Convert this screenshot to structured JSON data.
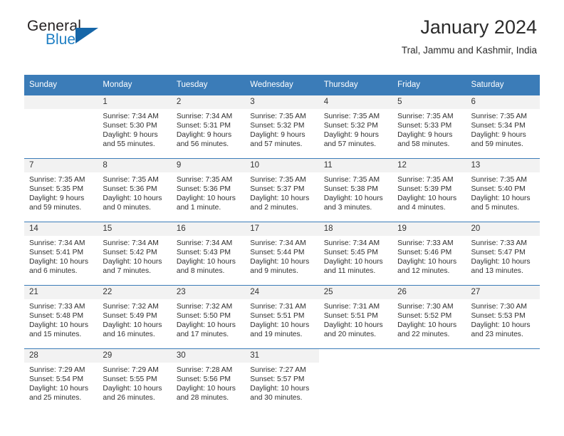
{
  "brand": {
    "name_top": "General",
    "name_bottom": "Blue",
    "triangle_color": "#1666a8",
    "blue_color": "#1f7fc4"
  },
  "header": {
    "title": "January 2024",
    "location": "Tral, Jammu and Kashmir, India"
  },
  "theme": {
    "header_blue": "#3b7cb8",
    "cell_head_gray": "#f2f2f2"
  },
  "calendar": {
    "weekday_headers": [
      "Sunday",
      "Monday",
      "Tuesday",
      "Wednesday",
      "Thursday",
      "Friday",
      "Saturday"
    ],
    "weeks": [
      [
        {
          "day": "",
          "lines": []
        },
        {
          "day": "1",
          "lines": [
            "Sunrise: 7:34 AM",
            "Sunset: 5:30 PM",
            "Daylight: 9 hours",
            "and 55 minutes."
          ]
        },
        {
          "day": "2",
          "lines": [
            "Sunrise: 7:34 AM",
            "Sunset: 5:31 PM",
            "Daylight: 9 hours",
            "and 56 minutes."
          ]
        },
        {
          "day": "3",
          "lines": [
            "Sunrise: 7:35 AM",
            "Sunset: 5:32 PM",
            "Daylight: 9 hours",
            "and 57 minutes."
          ]
        },
        {
          "day": "4",
          "lines": [
            "Sunrise: 7:35 AM",
            "Sunset: 5:32 PM",
            "Daylight: 9 hours",
            "and 57 minutes."
          ]
        },
        {
          "day": "5",
          "lines": [
            "Sunrise: 7:35 AM",
            "Sunset: 5:33 PM",
            "Daylight: 9 hours",
            "and 58 minutes."
          ]
        },
        {
          "day": "6",
          "lines": [
            "Sunrise: 7:35 AM",
            "Sunset: 5:34 PM",
            "Daylight: 9 hours",
            "and 59 minutes."
          ]
        }
      ],
      [
        {
          "day": "7",
          "lines": [
            "Sunrise: 7:35 AM",
            "Sunset: 5:35 PM",
            "Daylight: 9 hours",
            "and 59 minutes."
          ]
        },
        {
          "day": "8",
          "lines": [
            "Sunrise: 7:35 AM",
            "Sunset: 5:36 PM",
            "Daylight: 10 hours",
            "and 0 minutes."
          ]
        },
        {
          "day": "9",
          "lines": [
            "Sunrise: 7:35 AM",
            "Sunset: 5:36 PM",
            "Daylight: 10 hours",
            "and 1 minute."
          ]
        },
        {
          "day": "10",
          "lines": [
            "Sunrise: 7:35 AM",
            "Sunset: 5:37 PM",
            "Daylight: 10 hours",
            "and 2 minutes."
          ]
        },
        {
          "day": "11",
          "lines": [
            "Sunrise: 7:35 AM",
            "Sunset: 5:38 PM",
            "Daylight: 10 hours",
            "and 3 minutes."
          ]
        },
        {
          "day": "12",
          "lines": [
            "Sunrise: 7:35 AM",
            "Sunset: 5:39 PM",
            "Daylight: 10 hours",
            "and 4 minutes."
          ]
        },
        {
          "day": "13",
          "lines": [
            "Sunrise: 7:35 AM",
            "Sunset: 5:40 PM",
            "Daylight: 10 hours",
            "and 5 minutes."
          ]
        }
      ],
      [
        {
          "day": "14",
          "lines": [
            "Sunrise: 7:34 AM",
            "Sunset: 5:41 PM",
            "Daylight: 10 hours",
            "and 6 minutes."
          ]
        },
        {
          "day": "15",
          "lines": [
            "Sunrise: 7:34 AM",
            "Sunset: 5:42 PM",
            "Daylight: 10 hours",
            "and 7 minutes."
          ]
        },
        {
          "day": "16",
          "lines": [
            "Sunrise: 7:34 AM",
            "Sunset: 5:43 PM",
            "Daylight: 10 hours",
            "and 8 minutes."
          ]
        },
        {
          "day": "17",
          "lines": [
            "Sunrise: 7:34 AM",
            "Sunset: 5:44 PM",
            "Daylight: 10 hours",
            "and 9 minutes."
          ]
        },
        {
          "day": "18",
          "lines": [
            "Sunrise: 7:34 AM",
            "Sunset: 5:45 PM",
            "Daylight: 10 hours",
            "and 11 minutes."
          ]
        },
        {
          "day": "19",
          "lines": [
            "Sunrise: 7:33 AM",
            "Sunset: 5:46 PM",
            "Daylight: 10 hours",
            "and 12 minutes."
          ]
        },
        {
          "day": "20",
          "lines": [
            "Sunrise: 7:33 AM",
            "Sunset: 5:47 PM",
            "Daylight: 10 hours",
            "and 13 minutes."
          ]
        }
      ],
      [
        {
          "day": "21",
          "lines": [
            "Sunrise: 7:33 AM",
            "Sunset: 5:48 PM",
            "Daylight: 10 hours",
            "and 15 minutes."
          ]
        },
        {
          "day": "22",
          "lines": [
            "Sunrise: 7:32 AM",
            "Sunset: 5:49 PM",
            "Daylight: 10 hours",
            "and 16 minutes."
          ]
        },
        {
          "day": "23",
          "lines": [
            "Sunrise: 7:32 AM",
            "Sunset: 5:50 PM",
            "Daylight: 10 hours",
            "and 17 minutes."
          ]
        },
        {
          "day": "24",
          "lines": [
            "Sunrise: 7:31 AM",
            "Sunset: 5:51 PM",
            "Daylight: 10 hours",
            "and 19 minutes."
          ]
        },
        {
          "day": "25",
          "lines": [
            "Sunrise: 7:31 AM",
            "Sunset: 5:51 PM",
            "Daylight: 10 hours",
            "and 20 minutes."
          ]
        },
        {
          "day": "26",
          "lines": [
            "Sunrise: 7:30 AM",
            "Sunset: 5:52 PM",
            "Daylight: 10 hours",
            "and 22 minutes."
          ]
        },
        {
          "day": "27",
          "lines": [
            "Sunrise: 7:30 AM",
            "Sunset: 5:53 PM",
            "Daylight: 10 hours",
            "and 23 minutes."
          ]
        }
      ],
      [
        {
          "day": "28",
          "lines": [
            "Sunrise: 7:29 AM",
            "Sunset: 5:54 PM",
            "Daylight: 10 hours",
            "and 25 minutes."
          ]
        },
        {
          "day": "29",
          "lines": [
            "Sunrise: 7:29 AM",
            "Sunset: 5:55 PM",
            "Daylight: 10 hours",
            "and 26 minutes."
          ]
        },
        {
          "day": "30",
          "lines": [
            "Sunrise: 7:28 AM",
            "Sunset: 5:56 PM",
            "Daylight: 10 hours",
            "and 28 minutes."
          ]
        },
        {
          "day": "31",
          "lines": [
            "Sunrise: 7:27 AM",
            "Sunset: 5:57 PM",
            "Daylight: 10 hours",
            "and 30 minutes."
          ]
        },
        {
          "day": "",
          "lines": []
        },
        {
          "day": "",
          "lines": []
        },
        {
          "day": "",
          "lines": []
        }
      ]
    ]
  }
}
